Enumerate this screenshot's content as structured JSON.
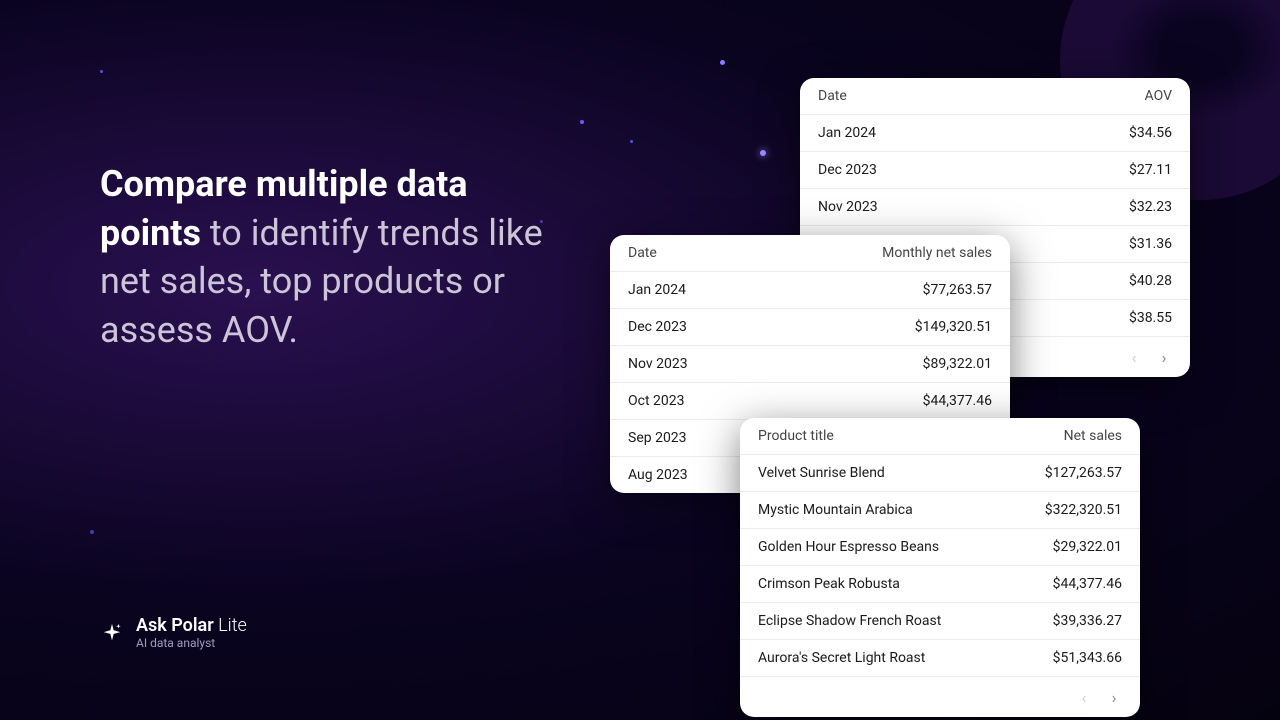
{
  "headline": {
    "bold": "Compare multiple data points",
    "rest": " to identify trends like net sales, top products or assess AOV."
  },
  "brand": {
    "name": "Ask Polar",
    "suffix": "Lite",
    "tagline": "AI data analyst"
  },
  "cards": {
    "aov": {
      "col1": "Date",
      "col2": "AOV",
      "rows": [
        {
          "a": "Jan 2024",
          "b": "$34.56"
        },
        {
          "a": "Dec 2023",
          "b": "$27.11"
        },
        {
          "a": "Nov 2023",
          "b": "$32.23"
        },
        {
          "a": "",
          "b": "$31.36"
        },
        {
          "a": "",
          "b": "$40.28"
        },
        {
          "a": "",
          "b": "$38.55"
        }
      ]
    },
    "monthly": {
      "col1": "Date",
      "col2": "Monthly net sales",
      "rows": [
        {
          "a": "Jan 2024",
          "b": "$77,263.57"
        },
        {
          "a": "Dec 2023",
          "b": "$149,320.51"
        },
        {
          "a": "Nov 2023",
          "b": "$89,322.01"
        },
        {
          "a": "Oct 2023",
          "b": "$44,377.46"
        },
        {
          "a": "Sep 2023",
          "b": ""
        },
        {
          "a": "Aug 2023",
          "b": ""
        }
      ]
    },
    "products": {
      "col1": "Product title",
      "col2": "Net sales",
      "rows": [
        {
          "a": "Velvet Sunrise Blend",
          "b": "$127,263.57"
        },
        {
          "a": "Mystic Mountain Arabica",
          "b": "$322,320.51"
        },
        {
          "a": "Golden Hour Espresso Beans",
          "b": "$29,322.01"
        },
        {
          "a": "Crimson Peak Robusta",
          "b": "$44,377.46"
        },
        {
          "a": "Eclipse Shadow French Roast",
          "b": "$39,336.27"
        },
        {
          "a": "Aurora's Secret Light Roast",
          "b": "$51,343.66"
        }
      ]
    }
  }
}
